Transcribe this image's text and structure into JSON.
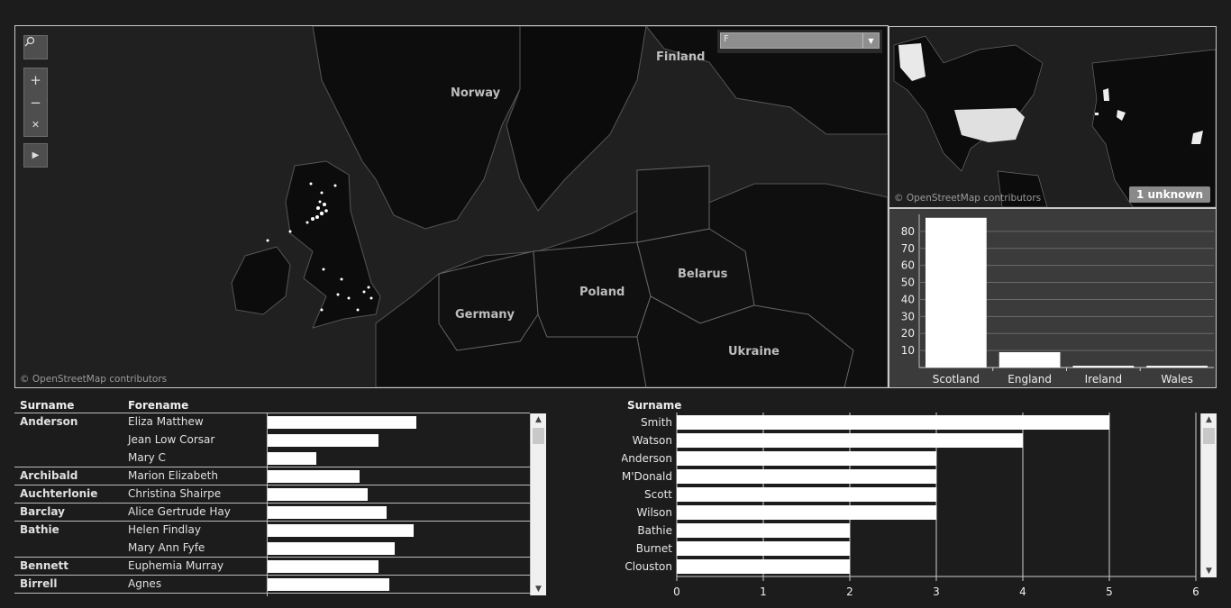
{
  "main_map": {
    "filter_value": "F",
    "attribution": "© OpenStreetMap contributors",
    "labels": [
      "Norway",
      "Finland",
      "Germany",
      "Poland",
      "Belarus",
      "Ukraine"
    ],
    "tools": [
      "search-icon",
      "plus-icon",
      "minus-icon",
      "pin-clear-icon",
      "play-icon"
    ]
  },
  "inset_map": {
    "attribution": "© OpenStreetMap contributors",
    "unknown_label": "1 unknown"
  },
  "country_chart": {
    "chart_data": {
      "type": "bar",
      "categories": [
        "Scotland",
        "England",
        "Ireland",
        "Wales"
      ],
      "values": [
        88,
        9,
        1,
        1
      ],
      "ylim": [
        0,
        90
      ],
      "yticks": [
        10,
        20,
        30,
        40,
        50,
        60,
        70,
        80
      ],
      "grid": true
    }
  },
  "names_table": {
    "headers": {
      "surname": "Surname",
      "forename": "Forename"
    },
    "rows": [
      {
        "surname": "Anderson",
        "forename": "Eliza Matthew",
        "value": 0.55
      },
      {
        "surname": "",
        "forename": "Jean Low Corsar",
        "value": 0.41
      },
      {
        "surname": "",
        "forename": "Mary C",
        "value": 0.18
      },
      {
        "surname": "Archibald",
        "forename": "Marion Elizabeth",
        "value": 0.34
      },
      {
        "surname": "Auchterlonie",
        "forename": "Christina Shairpe",
        "value": 0.37
      },
      {
        "surname": "Barclay",
        "forename": "Alice Gertrude Hay",
        "value": 0.44
      },
      {
        "surname": "Bathie",
        "forename": "Helen Findlay",
        "value": 0.54
      },
      {
        "surname": "",
        "forename": "Mary Ann Fyfe",
        "value": 0.47
      },
      {
        "surname": "Bennett",
        "forename": "Euphemia Murray",
        "value": 0.41
      },
      {
        "surname": "Birrell",
        "forename": "Agnes",
        "value": 0.45
      }
    ]
  },
  "surname_chart": {
    "header": "Surname",
    "chart_data": {
      "type": "bar",
      "orientation": "horizontal",
      "categories": [
        "Smith",
        "Watson",
        "Anderson",
        "M'Donald",
        "Scott",
        "Wilson",
        "Bathie",
        "Burnet",
        "Clouston"
      ],
      "values": [
        5,
        4,
        3,
        3,
        3,
        3,
        2,
        2,
        2
      ],
      "xlim": [
        0,
        6
      ],
      "xticks": [
        "0",
        "1",
        "2",
        "3",
        "4",
        "5",
        "6"
      ],
      "grid": true
    }
  }
}
